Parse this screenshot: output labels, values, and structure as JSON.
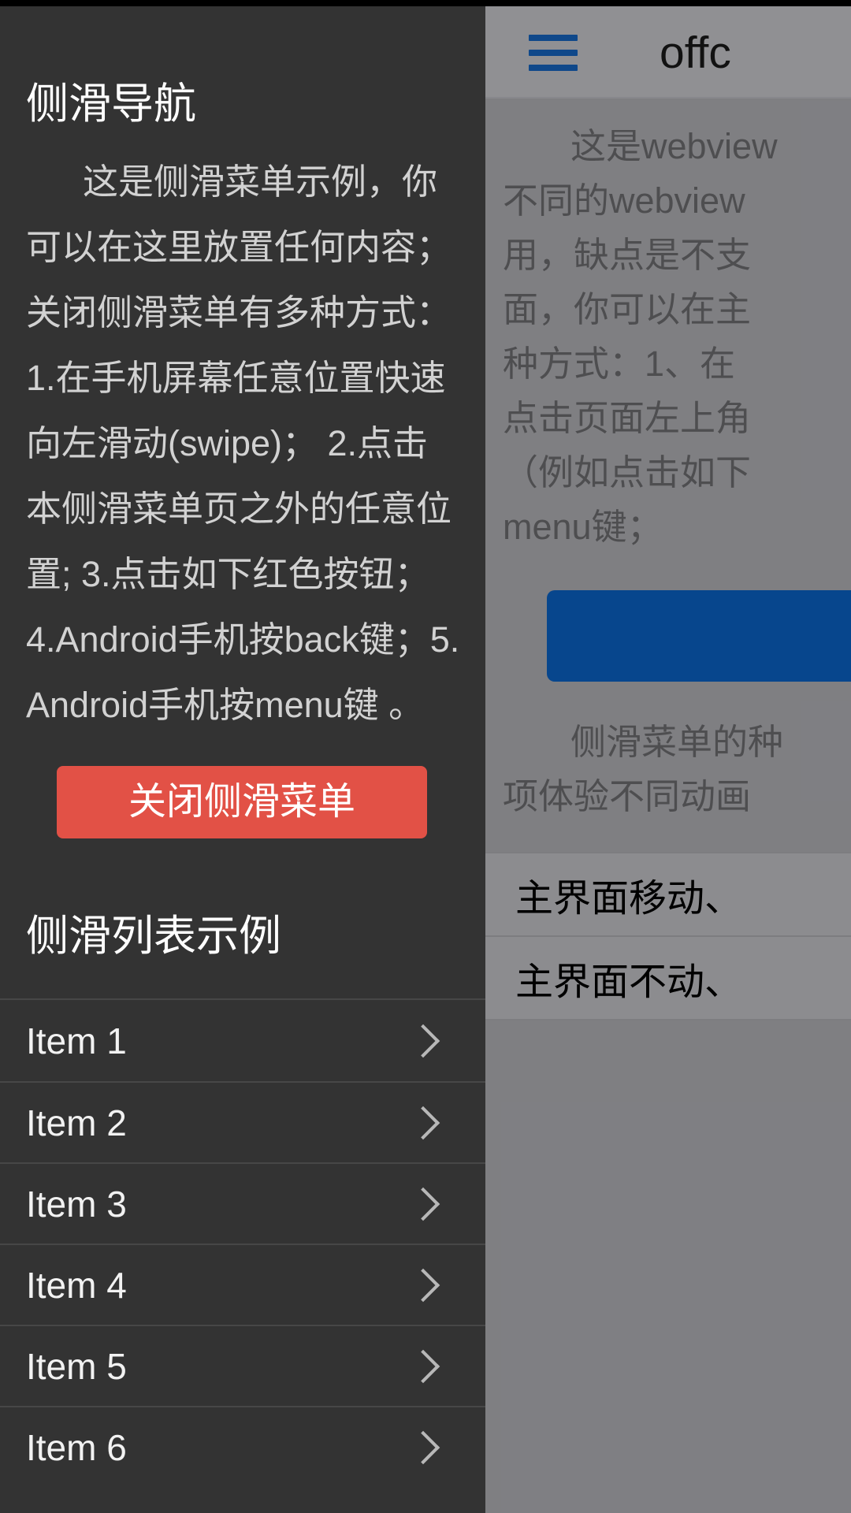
{
  "main_page": {
    "header": {
      "menu_icon": "hamburger-icon",
      "title": "offc"
    },
    "paragraph_1": "这是webview\n不同的webview\n用，缺点是不支\n面，你可以在主\n种方式：1、在\n点击页面左上角\n（例如点击如下\nmenu键；",
    "blue_button_label": "",
    "paragraph_2": "侧滑菜单的种\n项体验不同动画",
    "list_items": [
      {
        "label": "主界面移动、"
      },
      {
        "label": "主界面不动、"
      }
    ]
  },
  "drawer": {
    "title": "侧滑导航",
    "paragraph": "这是侧滑菜单示例，你可以在这里放置任何内容；关闭侧滑菜单有多种方式： 1.在手机屏幕任意位置快速向左滑动(swipe)； 2.点击本侧滑菜单页之外的任意位置; 3.点击如下红色按钮； 4.Android手机按back键；5.Android手机按menu键 。",
    "close_button_label": "关闭侧滑菜单",
    "subtitle": "侧滑列表示例",
    "list_items": [
      {
        "label": "Item 1",
        "chevron": "chevron-right-icon"
      },
      {
        "label": "Item 2",
        "chevron": "chevron-right-icon"
      },
      {
        "label": "Item 3",
        "chevron": "chevron-right-icon"
      },
      {
        "label": "Item 4",
        "chevron": "chevron-right-icon"
      },
      {
        "label": "Item 5",
        "chevron": "chevron-right-icon"
      },
      {
        "label": "Item 6",
        "chevron": "chevron-right-icon"
      }
    ]
  },
  "colors": {
    "drawer_background": "#333333",
    "close_button": "#e25146",
    "blue_button": "#0b61c4",
    "hamburger": "#1565c0",
    "page_background": "#b0b0b5",
    "header_background": "#c8c8cc"
  }
}
